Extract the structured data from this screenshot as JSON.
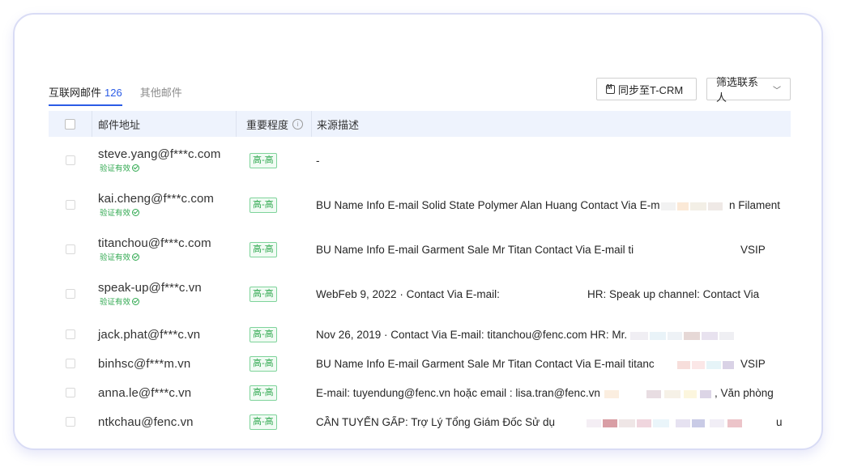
{
  "tabs": [
    {
      "label": "互联网邮件",
      "count": "126"
    },
    {
      "label": "其他邮件"
    }
  ],
  "actions": {
    "sync_label": "同步至T-CRM",
    "filter_label": "筛选联系人"
  },
  "table": {
    "headers": {
      "email": "邮件地址",
      "importance": "重要程度",
      "source": "来源描述"
    },
    "rows": [
      {
        "email": "steve.yang@f***c.com",
        "verified": "验证有效",
        "importance": "高-高",
        "source": "-"
      },
      {
        "email": "kai.cheng@f***c.com",
        "verified": "验证有效",
        "importance": "高-高",
        "source": "BU Name Info E-mail Solid State Polymer Alan Huang Contact Via E-m",
        "source_tail": "n Filament"
      },
      {
        "email": "titanchou@f***c.com",
        "verified": "验证有效",
        "importance": "高-高",
        "source": "BU Name Info E-mail Garment Sale Mr Titan Contact Via E-mail ti",
        "source_tail": "VSIP"
      },
      {
        "email": "speak-up@f***c.vn",
        "verified": "验证有效",
        "importance": "高-高",
        "source": "WebFeb 9, 2022 · Contact Via E-mail:",
        "source_tail": "HR: Speak up channel: Contact Via"
      },
      {
        "email": "jack.phat@f***c.vn",
        "importance": "高-高",
        "source": "Nov 26, 2019 · Contact Via E-mail: titanchou@fenc.com HR: Mr."
      },
      {
        "email": "binhsc@f***m.vn",
        "importance": "高-高",
        "source": "BU Name Info E-mail Garment Sale Mr Titan Contact Via E-mail titanc",
        "source_tail": "VSIP"
      },
      {
        "email": "anna.le@f***c.vn",
        "importance": "高-高",
        "source": "E-mail: tuyendung@fenc.vn hoặc email : lisa.tran@fenc.vn",
        "source_tail": ", Văn phòng"
      },
      {
        "email": "ntkchau@fenc.vn",
        "importance": "高-高",
        "source": "CẦN TUYỂN GẤP: Trợ Lý Tổng Giám Đốc Sử dụ",
        "source_tail": "u"
      }
    ]
  },
  "colors": {
    "accent": "#2b5ce6",
    "success": "#2fa84f",
    "header_bg": "#eef3fd",
    "card_border": "#d9dcf5"
  }
}
